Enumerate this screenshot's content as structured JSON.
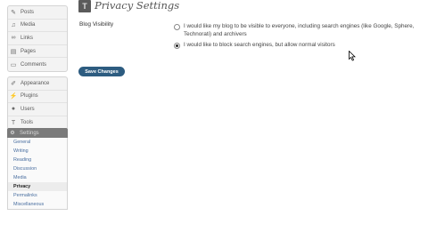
{
  "sidebar": {
    "group1": [
      {
        "label": "Posts",
        "icon": "pushpin-icon"
      },
      {
        "label": "Media",
        "icon": "media-icon"
      },
      {
        "label": "Links",
        "icon": "link-icon"
      },
      {
        "label": "Pages",
        "icon": "page-icon"
      },
      {
        "label": "Comments",
        "icon": "comment-icon"
      }
    ],
    "group2": [
      {
        "label": "Appearance",
        "icon": "brush-icon"
      },
      {
        "label": "Plugins",
        "icon": "plug-icon"
      },
      {
        "label": "Users",
        "icon": "user-icon"
      },
      {
        "label": "Tools",
        "icon": "tools-icon"
      }
    ],
    "settings": {
      "label": "Settings",
      "icon": "settings-icon"
    },
    "submenu": [
      {
        "label": "General"
      },
      {
        "label": "Writing"
      },
      {
        "label": "Reading"
      },
      {
        "label": "Discussion"
      },
      {
        "label": "Media"
      },
      {
        "label": "Privacy"
      },
      {
        "label": "Permalinks"
      },
      {
        "label": "Miscellaneous"
      }
    ]
  },
  "page": {
    "title": "Privacy Settings",
    "field_label": "Blog Visibility",
    "options": [
      {
        "label": "I would like my blog to be visible to everyone, including search engines (like Google, Sphere, Technorati) and archivers",
        "checked": false
      },
      {
        "label": "I would like to block search engines, but allow normal visitors",
        "checked": true
      }
    ],
    "save_label": "Save Changes"
  },
  "colors": {
    "button": "#2d5c80",
    "settings_header": "#7a7a7a",
    "submenu_link": "#4a6fa0"
  }
}
